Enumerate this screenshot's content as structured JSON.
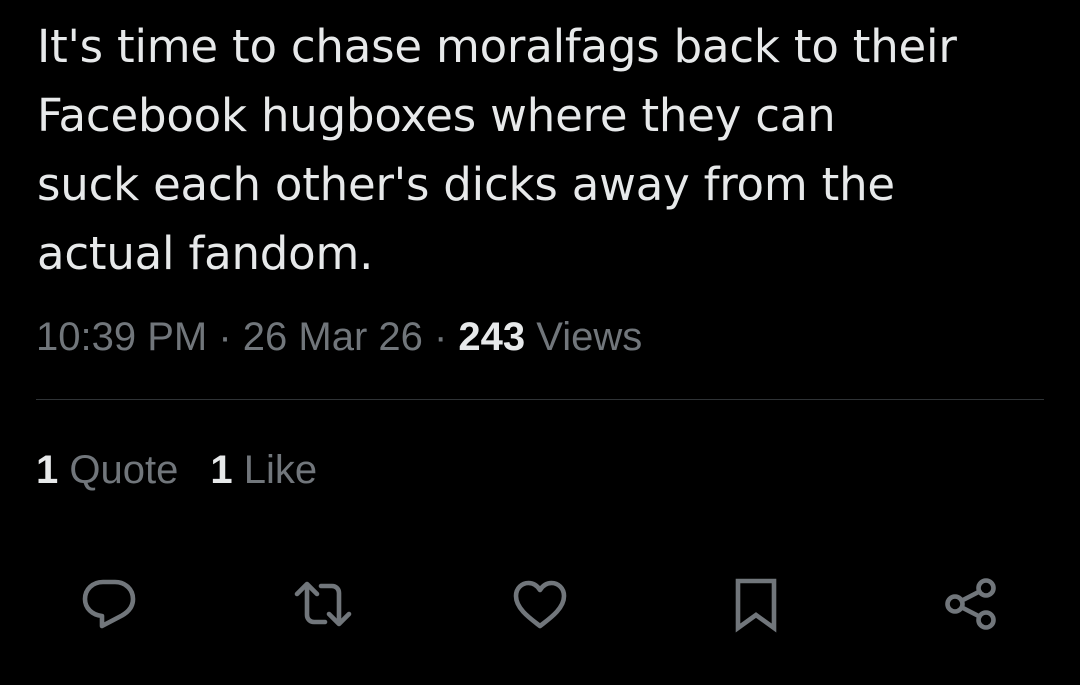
{
  "tweet": {
    "text_lines": [
      "It's time to chase moralfags back to their",
      "Facebook hugboxes where they can",
      "suck each other's dicks away from the",
      "actual fandom."
    ]
  },
  "meta": {
    "time": "10:39 PM",
    "separator": " · ",
    "date": "26 Mar 26",
    "views_count": "243",
    "views_label": " Views"
  },
  "stats": {
    "quotes_count": "1",
    "quotes_label": " Quote",
    "likes_count": "1",
    "likes_label": " Like"
  },
  "actions": [
    {
      "icon": "reply-icon"
    },
    {
      "icon": "retweet-icon"
    },
    {
      "icon": "like-icon"
    },
    {
      "icon": "bookmark-icon"
    },
    {
      "icon": "share-icon"
    }
  ],
  "colors": {
    "background": "#000000",
    "primary_text": "#e7e9ea",
    "secondary_text": "#71767b",
    "divider": "#2f3336"
  }
}
